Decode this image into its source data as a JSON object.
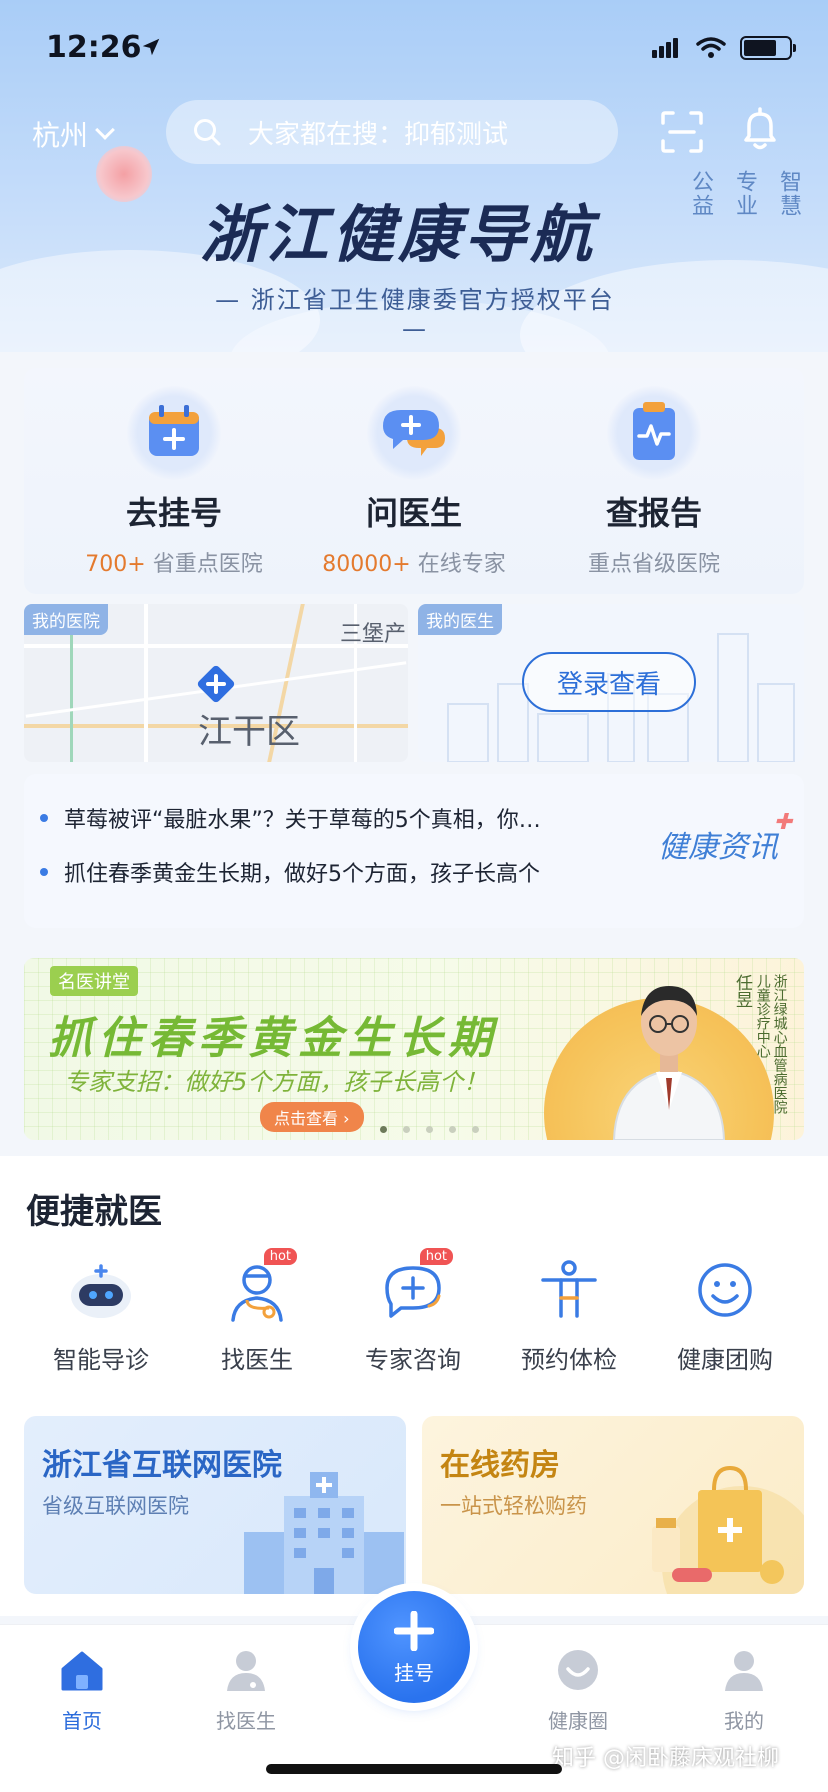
{
  "status_bar": {
    "time": "12:26"
  },
  "header": {
    "city": "杭州",
    "search_placeholder": "大家都在搜：抑郁测试",
    "slogan": [
      "公益",
      "专业",
      "智慧"
    ],
    "brand_title": "浙江健康导航",
    "brand_subtitle": "— 浙江省卫生健康委官方授权平台 —"
  },
  "services": [
    {
      "title": "去挂号",
      "num": "700+",
      "desc": "省重点医院",
      "icon": "calendar-plus-icon"
    },
    {
      "title": "问医生",
      "num": "80000+",
      "desc": "在线专家",
      "icon": "chat-plus-icon"
    },
    {
      "title": "查报告",
      "num": "",
      "desc": "重点省级医院",
      "icon": "report-clipboard-icon"
    }
  ],
  "my_hospital": {
    "tag": "我的医院",
    "district": "江干区",
    "place": "三堡产"
  },
  "my_doctor": {
    "tag": "我的医生",
    "login_label": "登录查看"
  },
  "news": {
    "items": [
      "草莓被评“最脏水果”？关于草莓的5个真相，你…",
      "抓住春季黄金生长期，做好5个方面，孩子长高个"
    ],
    "logo": "健康资讯"
  },
  "banner": {
    "badge": "名医讲堂",
    "headline": "抓住春季黄金生长期",
    "tagline": "专家支招：做好5个方面，孩子长高个！",
    "cta": "点击查看 ›",
    "doctor_name": "任昱",
    "doctor_hospital": "浙江绿城心血管病医院 儿童诊疗中心",
    "slides": 5,
    "active_slide": 1
  },
  "convenient": {
    "title": "便捷就医",
    "items": [
      {
        "label": "智能导诊",
        "icon": "robot-icon",
        "hot": ""
      },
      {
        "label": "找医生",
        "icon": "doctor-icon",
        "hot": "hot"
      },
      {
        "label": "专家咨询",
        "icon": "chat-plus-icon",
        "hot": "hot"
      },
      {
        "label": "预约体检",
        "icon": "person-icon",
        "hot": ""
      },
      {
        "label": "健康团购",
        "icon": "smile-icon",
        "hot": ""
      }
    ],
    "promos": [
      {
        "title": "浙江省互联网医院",
        "subtitle": "省级互联网医院"
      },
      {
        "title": "在线药房",
        "subtitle": "一站式轻松购药"
      }
    ]
  },
  "tabbar": {
    "tabs": [
      {
        "label": "首页",
        "icon": "home-icon",
        "active": true
      },
      {
        "label": "找医生",
        "icon": "doctor-icon",
        "active": false
      },
      {
        "label": "挂号",
        "icon": "plus-icon",
        "active": false
      },
      {
        "label": "健康圈",
        "icon": "circle-smile-icon",
        "active": false
      },
      {
        "label": "我的",
        "icon": "user-icon",
        "active": false
      }
    ]
  },
  "watermark": "知乎 @闲卧藤床观社柳",
  "colors": {
    "primary": "#2a6bdb",
    "accent_orange": "#e47a2e",
    "hot_red": "#f05454",
    "banner_green": "#76b935"
  }
}
